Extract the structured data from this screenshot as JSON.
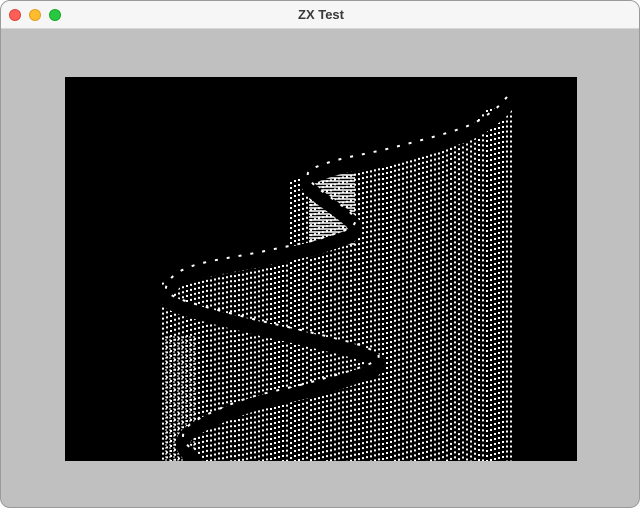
{
  "window": {
    "title": "ZX Test"
  },
  "screen": {
    "background_color": "#000000",
    "ink_color": "#ffffff",
    "border_color": "#c0c0c0"
  }
}
